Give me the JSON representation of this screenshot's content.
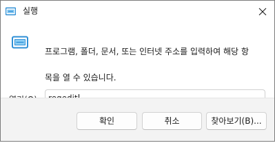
{
  "window": {
    "title": "실행",
    "title_icon": "run-dialog-icon",
    "close_icon": "close-icon"
  },
  "content": {
    "icon": "run-icon",
    "description_line1": "프로그램, 폴더, 문서, 또는 인터넷 주소를 입력하여 해당 항",
    "description_line2": "목을 열 수 있습니다.",
    "open_label_prefix": "열기(",
    "open_label_accel": "O",
    "open_label_suffix": "):",
    "open_value": "regedit",
    "dropdown_icon": "chevron-down-icon"
  },
  "buttons": {
    "ok": "확인",
    "cancel": "취소",
    "browse": "찾아보기(B)..."
  },
  "colors": {
    "accent": "#005fb8",
    "footer_bg": "#f3f3f3",
    "icon_blue": "#2e8fd6"
  }
}
